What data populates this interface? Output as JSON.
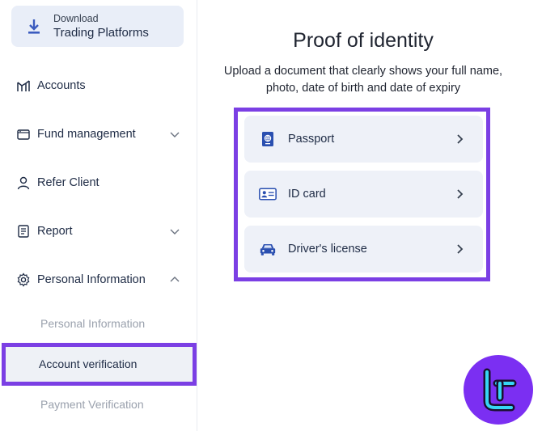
{
  "sidebar": {
    "download": {
      "small": "Download",
      "big": "Trading Platforms",
      "icon": "download-icon"
    },
    "items": [
      {
        "label": "Accounts",
        "icon": "chart-icon",
        "expandable": false
      },
      {
        "label": "Fund management",
        "icon": "wallet-icon",
        "expandable": true,
        "expanded": false
      },
      {
        "label": "Refer Client",
        "icon": "user-icon",
        "expandable": false
      },
      {
        "label": "Report",
        "icon": "document-icon",
        "expandable": true,
        "expanded": false
      },
      {
        "label": "Personal Information",
        "icon": "gear-icon",
        "expandable": true,
        "expanded": true
      }
    ],
    "subitems": [
      {
        "label": "Personal Information",
        "active": false
      },
      {
        "label": "Account verification",
        "active": true
      },
      {
        "label": "Payment Verification",
        "active": false
      }
    ]
  },
  "main": {
    "title": "Proof of identity",
    "description": "Upload a document that clearly shows your full name, photo, date of birth and date of expiry",
    "documents": [
      {
        "label": "Passport",
        "icon": "passport-icon"
      },
      {
        "label": "ID card",
        "icon": "id-card-icon"
      },
      {
        "label": "Driver's license",
        "icon": "car-icon"
      }
    ]
  },
  "colors": {
    "accent": "#7b3fe4",
    "navy": "#1e2b45",
    "iconBlue": "#2a4fb0",
    "buttonBg": "#eef1f8",
    "muted": "#9aa1ad"
  }
}
